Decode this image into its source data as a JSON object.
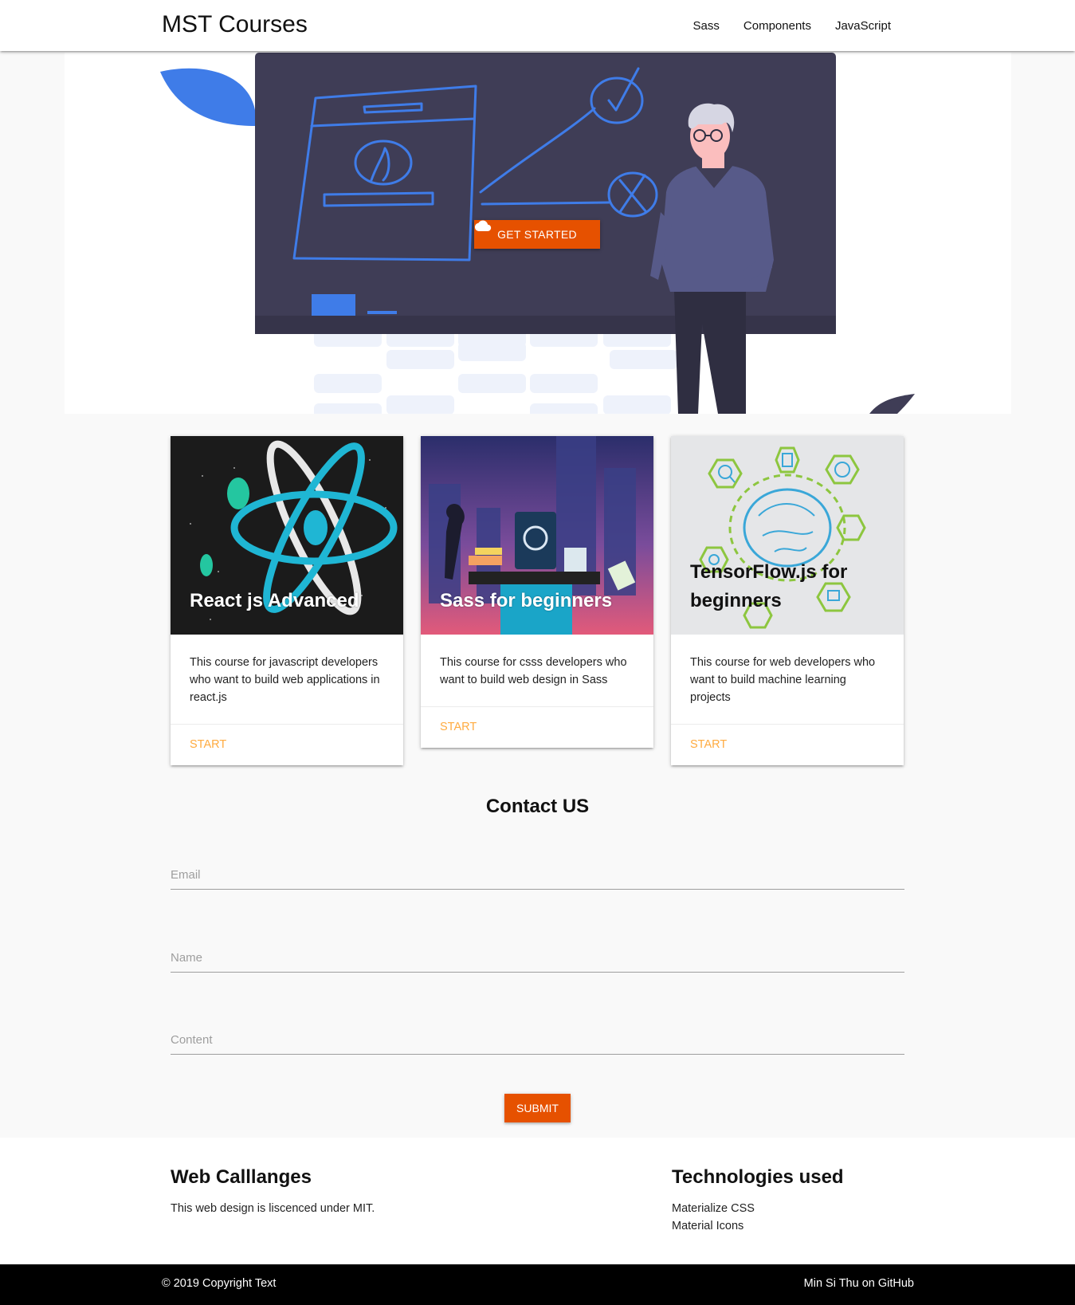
{
  "navbar": {
    "brand": "MST Courses",
    "links": [
      "Sass",
      "Components",
      "JavaScript"
    ]
  },
  "hero": {
    "button_label": "GET STARTED",
    "button_icon": "cloud-icon",
    "illustration": "teacher-at-blackboard-illustration"
  },
  "cards": [
    {
      "title": "React js Advanced",
      "image": "react-atom-space-illustration",
      "description": "This course for javascript developers who want to build web applications in react.js",
      "action": "START"
    },
    {
      "title": "Sass for beginners",
      "image": "sass-o-matic-city-illustration",
      "description": "This course for csss developers who want to build web design in Sass",
      "action": "START"
    },
    {
      "title": "TensorFlow.js for beginners",
      "image": "machine-learning-brain-illustration",
      "description": "This course for web developers who want to build machine learning projects",
      "action": "START"
    }
  ],
  "contact": {
    "title": "Contact US",
    "email_placeholder": "Email",
    "name_placeholder": "Name",
    "content_placeholder": "Content",
    "submit_label": "SUBMIT"
  },
  "footer": {
    "left_heading": "Web Calllanges",
    "left_text": "This web design is liscenced under MIT.",
    "right_heading": "Technologies used",
    "tech_links": [
      "Materialize CSS",
      "Material Icons"
    ],
    "copyright": "© 2019 Copyright Text",
    "github_link": "Min Si Thu on GitHub"
  },
  "colors": {
    "accent": "#e65100",
    "action_link": "#ffab40",
    "board": "#3f3d56",
    "sketch_blue": "#3f7ce8"
  }
}
